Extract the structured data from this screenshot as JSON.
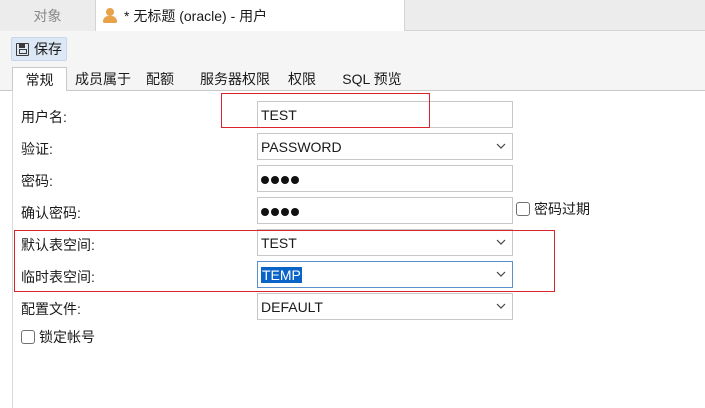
{
  "tabs": {
    "objects_label": "对象",
    "active_label": "* 无标题 (oracle) - 用户"
  },
  "toolbar": {
    "save_label": "保存"
  },
  "subtabs": [
    "常规",
    "成员属于",
    "配额",
    "服务器权限",
    "权限",
    "SQL 预览"
  ],
  "form": {
    "username_label": "用户名:",
    "username_value": "TEST",
    "auth_label": "验证:",
    "auth_value": "PASSWORD",
    "password_label": "密码:",
    "confirm_label": "确认密码:",
    "password_expired_label": "密码过期",
    "default_tablespace_label": "默认表空间:",
    "default_tablespace_value": "TEST",
    "temp_tablespace_label": "临时表空间:",
    "temp_tablespace_value": "TEMP",
    "profile_label": "配置文件:",
    "profile_value": "DEFAULT",
    "lock_account_label": "锁定帐号"
  },
  "colors": {
    "annotation": "#d9232d",
    "selection": "#0a64c8",
    "user_icon": "#e7a24a"
  }
}
